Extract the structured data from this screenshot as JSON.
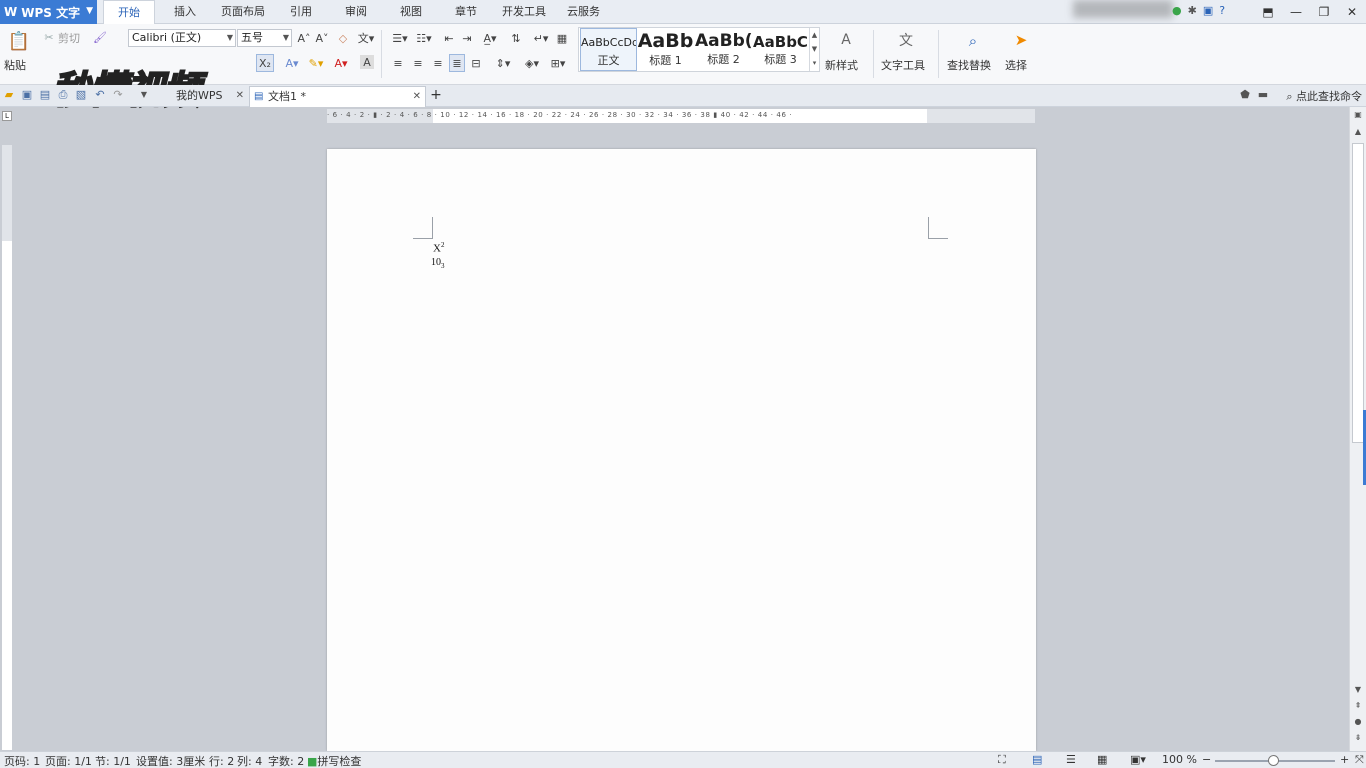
{
  "app": {
    "title": "WPS 文字",
    "logo": "W"
  },
  "menu": {
    "tabs": [
      "开始",
      "插入",
      "页面布局",
      "引用",
      "审阅",
      "视图",
      "章节",
      "开发工具",
      "云服务"
    ],
    "active": "开始"
  },
  "ribbon": {
    "paste": "粘贴",
    "cut": "剪切",
    "font_name": "Calibri (正文)",
    "font_size": "五号",
    "subscript": "X₂",
    "styles": [
      {
        "preview": "AaBbCcDd",
        "name": "正文"
      },
      {
        "preview": "AaBb",
        "name": "标题 1"
      },
      {
        "preview": "AaBb(",
        "name": "标题 2"
      },
      {
        "preview": "AaBbC",
        "name": "标题 3"
      }
    ],
    "new_style": "新样式",
    "text_tools": "文字工具",
    "find_replace": "查找替换",
    "select": "选择"
  },
  "watermark": "秒懂视频",
  "quick_access": {
    "doc_tabs": [
      {
        "label": "我的WPS"
      },
      {
        "label": "文档1 *"
      }
    ],
    "add_tab": "+",
    "command_search": "点此查找命令"
  },
  "ruler": {
    "ticks": "· 6 · 4 · 2 · ▮ · 2 · 4 · 6 · 8 · 10 · 12 · 14 · 16 · 18 · 20 · 22 · 24 · 26 · 28 · 30 · 32 · 34 · 36 · 38 ▮ 40 · 42 · 44 · 46 ·"
  },
  "document": {
    "line1_base": "X",
    "line1_sup": "2",
    "line2_base": "10",
    "line2_sub": "3"
  },
  "status": {
    "page_code": "页码: 1",
    "pages": "页面: 1/1",
    "section": "节: 1/1",
    "setting": "设置值: 3厘米",
    "row": "行: 2",
    "col": "列: 4",
    "words": "字数: 2",
    "spell": "拼写检查",
    "zoom": "100 %"
  },
  "colors": {
    "accent": "#3b7bd4",
    "page": "#fdfdfd",
    "background": "#c9cdd4"
  }
}
